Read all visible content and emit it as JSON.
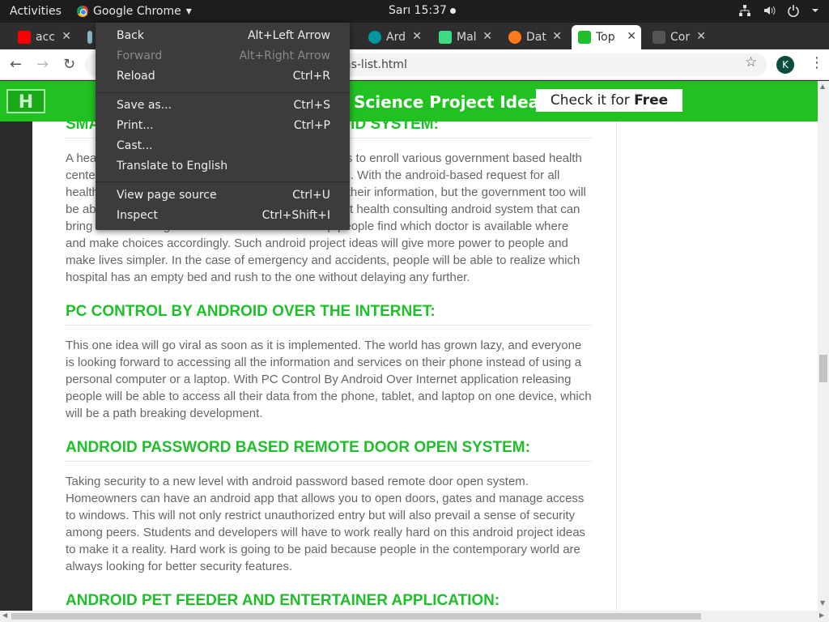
{
  "topbar": {
    "activities": "Activities",
    "app_name": "Google Chrome",
    "app_caret": "▾",
    "clock": "Sarı 15:37",
    "sys_icons": [
      "network-icon",
      "volume-icon",
      "power-icon",
      "caret-icon"
    ]
  },
  "tabs": [
    {
      "label": "acc",
      "icon": "youtube-icon",
      "color": "#ff0000"
    },
    {
      "label": "",
      "icon": "image-icon",
      "color": "#8aa"
    },
    {
      "label": "Ard",
      "icon": "arduino-icon",
      "color": "#00979d"
    },
    {
      "label": "Mal",
      "icon": "android-icon",
      "color": "#3ddc84"
    },
    {
      "label": "Dat",
      "icon": "orange-icon",
      "color": "#ff7a1a"
    },
    {
      "label": "Top",
      "icon": "page-icon",
      "color": "#1fbf2a",
      "active": true
    },
    {
      "label": "Cor",
      "icon": "blank-icon",
      "color": "#666"
    }
  ],
  "toolbar": {
    "url": "as-list.html",
    "profile_initial": "K"
  },
  "banner": {
    "logo_text": "H",
    "headline": "Science Project Ideas",
    "cta_prefix": "Check it for ",
    "cta_bold": "Free"
  },
  "article": {
    "sections": [
      {
        "heading": "SMART HEALTH CONSULTING ANDROID SYSTEM:",
        "body": "A health consulting android system would allow users to enroll various government based health centers on one platform, making it easy for the public. With the android-based request for all health centers, not only will people be able to get all their information, but the government too will be able to keep a check on all health centers. A smart health consulting android system that can bring all medical agencies under one roof will help people find which doctor is available where and make choices accordingly. Such android project ideas will give more power to people and make lives simpler. In the case of emergency and accidents, people will be able to realize which hospital has an empty bed and rush to the one without delaying any further."
      },
      {
        "heading": "PC CONTROL BY ANDROID OVER THE INTERNET:",
        "body": "This one idea will go viral as soon as it is implemented. The world has grown lazy, and everyone is looking forward to accessing all the information and services on their phone instead of using a personal computer or a laptop. With PC Control By Android Over Internet application releasing people will be able to access all their data from the phone, tablet, and laptop on one device, which will be a path breaking development."
      },
      {
        "heading": "ANDROID PASSWORD BASED REMOTE DOOR OPEN SYSTEM:",
        "body": "Taking security to a new level with android password based remote door open system. Homeowners can have an android app that allows you to open doors, gates and manage access to windows. This will not only restrict unauthorized entry but will also prevail a sense of security among peers. Students and developers will have to work really hard on this android project ideas to make it a reality. Hard work is going to be paid because people in the contemporary world are always looking for better security features."
      },
      {
        "heading": "ANDROID PET FEEDER AND ENTERTAINER APPLICATION:",
        "body": ""
      }
    ]
  },
  "context_menu": {
    "items": [
      {
        "label": "Back",
        "shortcut": "Alt+Left Arrow",
        "disabled": false
      },
      {
        "label": "Forward",
        "shortcut": "Alt+Right Arrow",
        "disabled": true
      },
      {
        "label": "Reload",
        "shortcut": "Ctrl+R",
        "disabled": false
      },
      {
        "label": "Save as...",
        "shortcut": "Ctrl+S",
        "disabled": false
      },
      {
        "label": "Print...",
        "shortcut": "Ctrl+P",
        "disabled": false
      },
      {
        "label": "Cast...",
        "shortcut": "",
        "disabled": false
      },
      {
        "label": "Translate to English",
        "shortcut": "",
        "disabled": false
      },
      {
        "label": "View page source",
        "shortcut": "Ctrl+U",
        "disabled": false
      },
      {
        "label": "Inspect",
        "shortcut": "Ctrl+Shift+I",
        "disabled": false
      }
    ]
  }
}
